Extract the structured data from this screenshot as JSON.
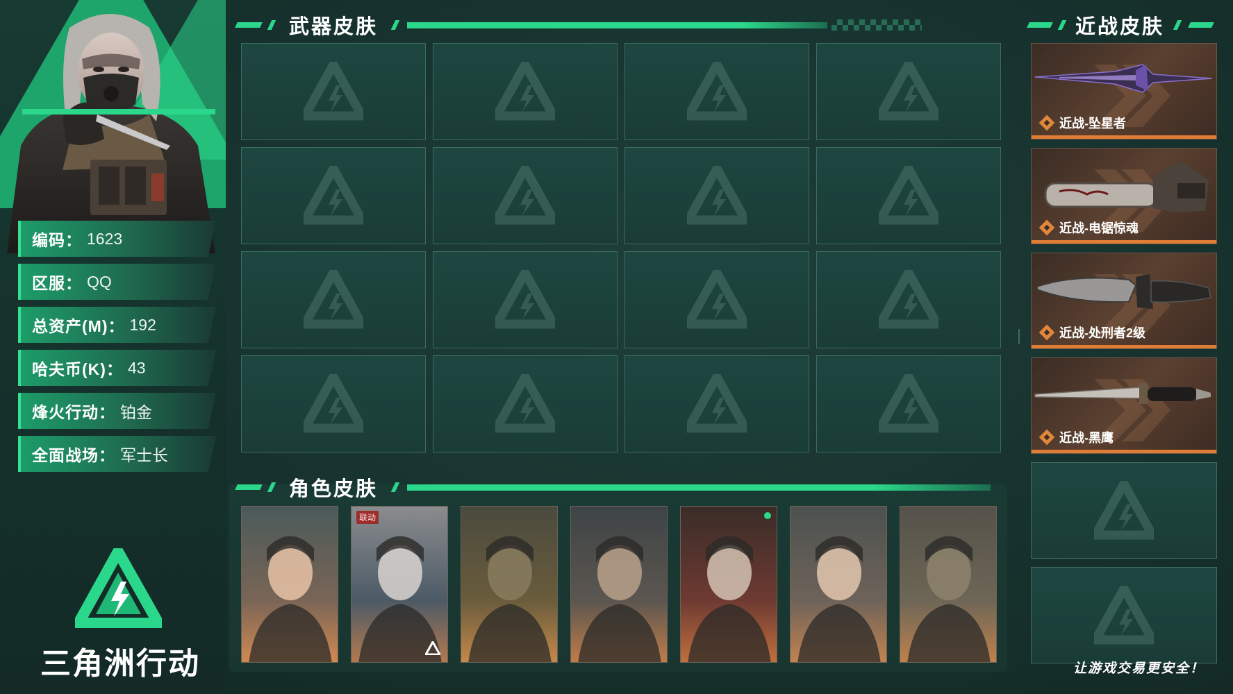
{
  "profile": {
    "fields": [
      {
        "key": "编码",
        "value": "1623"
      },
      {
        "key": "区服",
        "value": "QQ"
      },
      {
        "key": "总资产(M)",
        "value": "192"
      },
      {
        "key": "哈夫币(K)",
        "value": "43"
      },
      {
        "key": "烽火行动",
        "value": "铂金"
      },
      {
        "key": "全面战场",
        "value": "军士长"
      }
    ],
    "colon": "："
  },
  "logo": {
    "text": "三角洲行动"
  },
  "weapon_skins": {
    "title": "武器皮肤",
    "slot_count": 16,
    "filled": 0
  },
  "character_skins": {
    "title": "角色皮肤",
    "cards": [
      {
        "icon": "operator-portrait-icon"
      },
      {
        "icon": "operator-portrait-icon",
        "badge": "联动",
        "logo": "delta-logo-icon"
      },
      {
        "icon": "operator-portrait-icon"
      },
      {
        "icon": "operator-portrait-icon"
      },
      {
        "icon": "operator-portrait-icon",
        "dot": true
      },
      {
        "icon": "operator-portrait-icon"
      },
      {
        "icon": "operator-portrait-icon"
      }
    ]
  },
  "melee_skins": {
    "title": "近战皮肤",
    "items": [
      {
        "label": "近战-坠星者",
        "icon": "dagger-icon"
      },
      {
        "label": "近战-电锯惊魂",
        "icon": "chainsaw-icon"
      },
      {
        "label": "近战-处刑者2级",
        "icon": "combat-knife-icon"
      },
      {
        "label": "近战-黑鹰",
        "icon": "bayonet-icon"
      }
    ],
    "empty_slots": 2
  },
  "slogan": "让游戏交易更安全！",
  "colors": {
    "accent": "#2bd78a",
    "background": "#17322e",
    "melee_stripe": "#e07d35"
  }
}
